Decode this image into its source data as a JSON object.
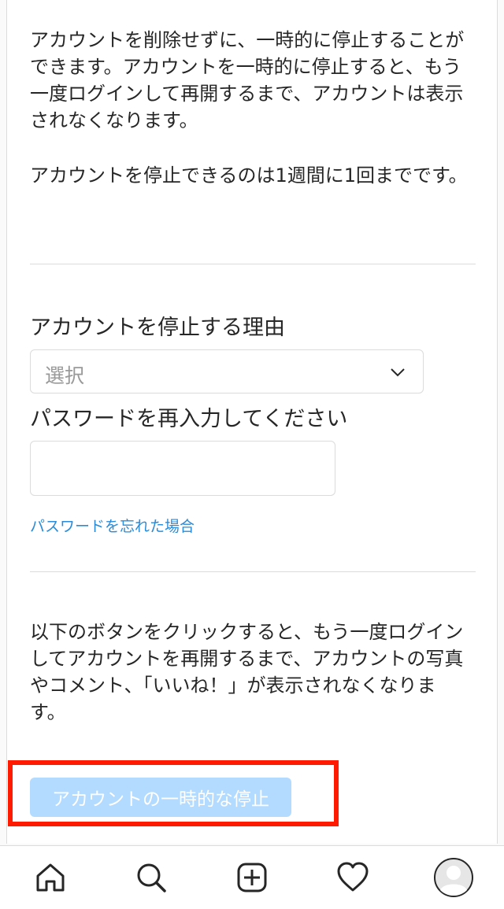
{
  "intro": {
    "paragraph_1": "アカウントを削除せずに、一時的に停止することができます。アカウントを一時的に停止すると、もう一度ログインして再開するまで、アカウントは表示されなくなります。",
    "paragraph_2": "アカウントを停止できるのは1週間に1回までです。"
  },
  "form": {
    "reason_label": "アカウントを停止する理由",
    "reason_select_value": "選択",
    "password_label": "パスワードを再入力してください",
    "password_value": "",
    "forgot_password_link": "パスワードを忘れた場合"
  },
  "confirm": {
    "notice": "以下のボタンをクリックすると、もう一度ログインしてアカウントを再開するまで、アカウントの写真やコメント、「いいね！」が表示されなくなります。",
    "disable_button_label": "アカウントの一時的な停止"
  },
  "colors": {
    "link": "#2a8bd8",
    "button_disabled": "#b3dbff",
    "highlight_border": "#ff1a00"
  },
  "tab_bar": {
    "icons": [
      "home-icon",
      "search-icon",
      "add-post-icon",
      "activity-heart-icon",
      "profile-avatar-icon"
    ]
  }
}
